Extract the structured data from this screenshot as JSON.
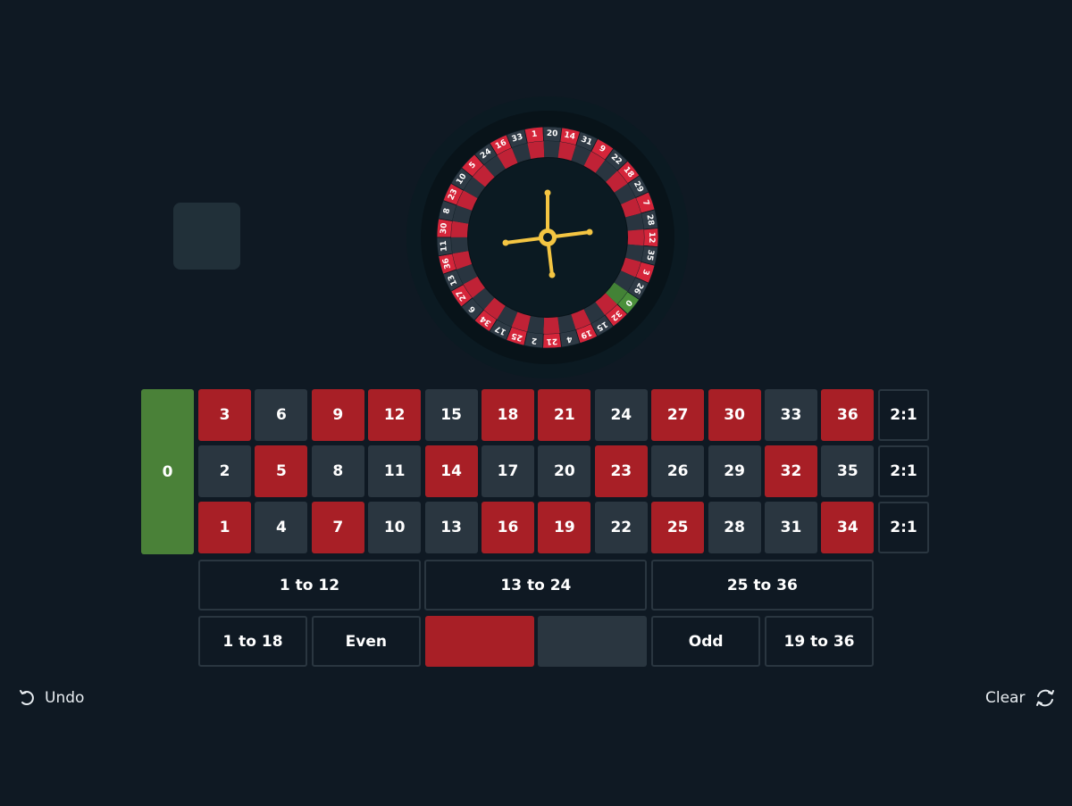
{
  "colors": {
    "background": "#0f1923",
    "red": "#a81f26",
    "black": "#2a3640",
    "green": "#4a8138",
    "wheel_red": "#d5253a",
    "wheel_black": "#2e3a45",
    "wheel_green": "#4a8f3a",
    "spinner": "#f4c542"
  },
  "wheel": {
    "pockets": [
      {
        "n": "0",
        "c": "green"
      },
      {
        "n": "32",
        "c": "red"
      },
      {
        "n": "15",
        "c": "black"
      },
      {
        "n": "19",
        "c": "red"
      },
      {
        "n": "4",
        "c": "black"
      },
      {
        "n": "21",
        "c": "red"
      },
      {
        "n": "2",
        "c": "black"
      },
      {
        "n": "25",
        "c": "red"
      },
      {
        "n": "17",
        "c": "black"
      },
      {
        "n": "34",
        "c": "red"
      },
      {
        "n": "6",
        "c": "black"
      },
      {
        "n": "27",
        "c": "red"
      },
      {
        "n": "13",
        "c": "black"
      },
      {
        "n": "36",
        "c": "red"
      },
      {
        "n": "11",
        "c": "black"
      },
      {
        "n": "30",
        "c": "red"
      },
      {
        "n": "8",
        "c": "black"
      },
      {
        "n": "23",
        "c": "red"
      },
      {
        "n": "10",
        "c": "black"
      },
      {
        "n": "5",
        "c": "red"
      },
      {
        "n": "24",
        "c": "black"
      },
      {
        "n": "16",
        "c": "red"
      },
      {
        "n": "33",
        "c": "black"
      },
      {
        "n": "1",
        "c": "red"
      },
      {
        "n": "20",
        "c": "black"
      },
      {
        "n": "14",
        "c": "red"
      },
      {
        "n": "31",
        "c": "black"
      },
      {
        "n": "9",
        "c": "red"
      },
      {
        "n": "22",
        "c": "black"
      },
      {
        "n": "18",
        "c": "red"
      },
      {
        "n": "29",
        "c": "black"
      },
      {
        "n": "7",
        "c": "red"
      },
      {
        "n": "28",
        "c": "black"
      },
      {
        "n": "12",
        "c": "red"
      },
      {
        "n": "35",
        "c": "black"
      },
      {
        "n": "3",
        "c": "red"
      },
      {
        "n": "26",
        "c": "black"
      }
    ]
  },
  "table": {
    "zero": {
      "label": "0",
      "color": "green"
    },
    "rows": [
      [
        {
          "n": "3",
          "c": "red"
        },
        {
          "n": "6",
          "c": "black"
        },
        {
          "n": "9",
          "c": "red"
        },
        {
          "n": "12",
          "c": "red"
        },
        {
          "n": "15",
          "c": "black"
        },
        {
          "n": "18",
          "c": "red"
        },
        {
          "n": "21",
          "c": "red"
        },
        {
          "n": "24",
          "c": "black"
        },
        {
          "n": "27",
          "c": "red"
        },
        {
          "n": "30",
          "c": "red"
        },
        {
          "n": "33",
          "c": "black"
        },
        {
          "n": "36",
          "c": "red"
        }
      ],
      [
        {
          "n": "2",
          "c": "black"
        },
        {
          "n": "5",
          "c": "red"
        },
        {
          "n": "8",
          "c": "black"
        },
        {
          "n": "11",
          "c": "black"
        },
        {
          "n": "14",
          "c": "red"
        },
        {
          "n": "17",
          "c": "black"
        },
        {
          "n": "20",
          "c": "black"
        },
        {
          "n": "23",
          "c": "red"
        },
        {
          "n": "26",
          "c": "black"
        },
        {
          "n": "29",
          "c": "black"
        },
        {
          "n": "32",
          "c": "red"
        },
        {
          "n": "35",
          "c": "black"
        }
      ],
      [
        {
          "n": "1",
          "c": "red"
        },
        {
          "n": "4",
          "c": "black"
        },
        {
          "n": "7",
          "c": "red"
        },
        {
          "n": "10",
          "c": "black"
        },
        {
          "n": "13",
          "c": "black"
        },
        {
          "n": "16",
          "c": "red"
        },
        {
          "n": "19",
          "c": "red"
        },
        {
          "n": "22",
          "c": "black"
        },
        {
          "n": "25",
          "c": "red"
        },
        {
          "n": "28",
          "c": "black"
        },
        {
          "n": "31",
          "c": "black"
        },
        {
          "n": "34",
          "c": "red"
        }
      ]
    ],
    "columns": [
      "2:1",
      "2:1",
      "2:1"
    ],
    "dozens": [
      "1 to 12",
      "13 to 24",
      "25 to 36"
    ],
    "outside": [
      {
        "label": "1 to 18",
        "style": "outline",
        "name": "bet-1-to-18"
      },
      {
        "label": "Even",
        "style": "outline",
        "name": "bet-even"
      },
      {
        "label": "",
        "style": "red",
        "name": "bet-red"
      },
      {
        "label": "",
        "style": "black",
        "name": "bet-black"
      },
      {
        "label": "Odd",
        "style": "outline",
        "name": "bet-odd"
      },
      {
        "label": "19 to 36",
        "style": "outline",
        "name": "bet-19-to-36"
      }
    ]
  },
  "controls": {
    "undo_label": "Undo",
    "clear_label": "Clear",
    "undo_icon": "undo-icon",
    "clear_icon": "refresh-icon"
  }
}
